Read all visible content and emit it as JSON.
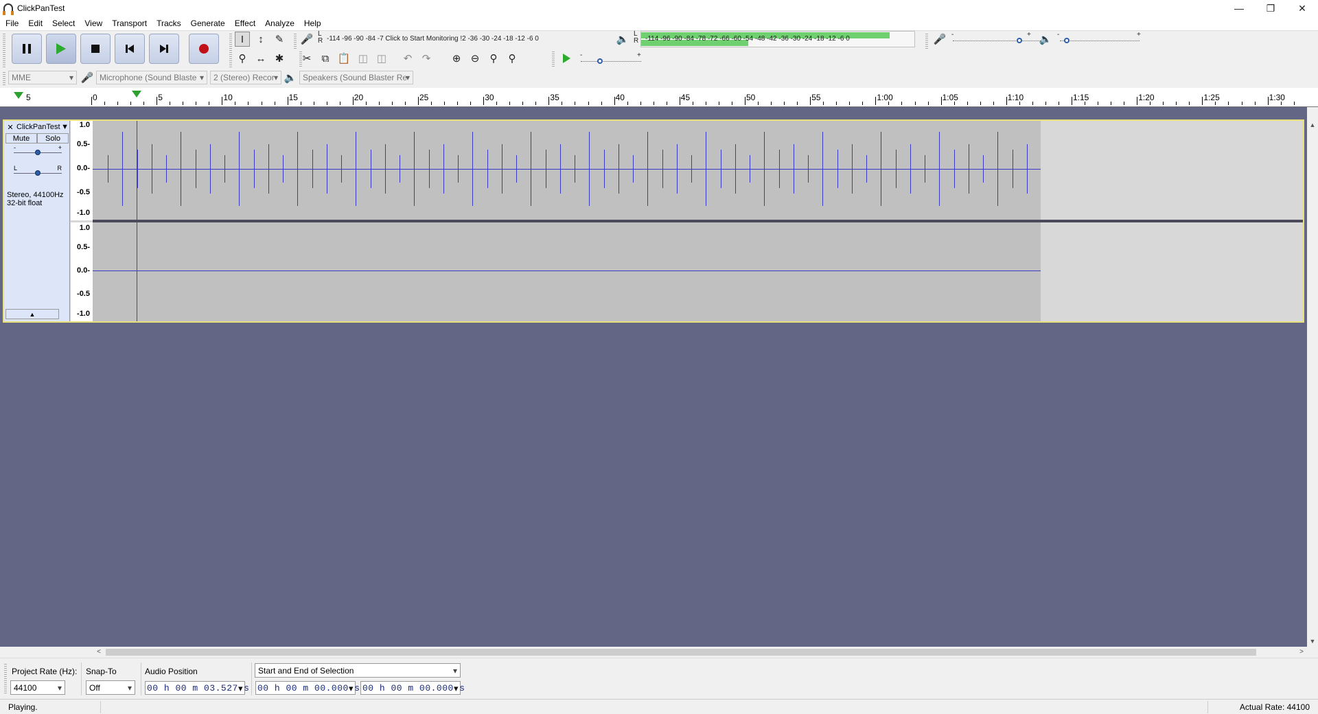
{
  "window": {
    "title": "ClickPanTest"
  },
  "menu": [
    "File",
    "Edit",
    "Select",
    "View",
    "Transport",
    "Tracks",
    "Generate",
    "Effect",
    "Analyze",
    "Help"
  ],
  "meters": {
    "record": {
      "lr": "L\nR",
      "scale": "-114   -96 -90 -84 -7 Click to Start Monitoring !2 -36 -30 -24 -18 -12  -6  0"
    },
    "playback": {
      "scale": "-114       -96 -90 -84 -78 -72 -66 -60 -54 -48 -42 -36 -30 -24 -18 -12  -6  0"
    }
  },
  "device_toolbar": {
    "host": "MME",
    "input": "Microphone (Sound Blaste",
    "channels": "2 (Stereo) Recor",
    "output": "Speakers (Sound Blaster Re"
  },
  "ruler": {
    "labels": [
      {
        "t": "5",
        "start": true
      },
      {
        "t": "0"
      },
      {
        "t": "5"
      },
      {
        "t": "10"
      },
      {
        "t": "15"
      },
      {
        "t": "20"
      },
      {
        "t": "25"
      },
      {
        "t": "30"
      },
      {
        "t": "35"
      },
      {
        "t": "40"
      },
      {
        "t": "45"
      },
      {
        "t": "50"
      },
      {
        "t": "55"
      },
      {
        "t": "1:00"
      },
      {
        "t": "1:05"
      },
      {
        "t": "1:10"
      },
      {
        "t": "1:15"
      },
      {
        "t": "1:20"
      },
      {
        "t": "1:25"
      },
      {
        "t": "1:30"
      }
    ]
  },
  "track": {
    "name": "ClickPanTest",
    "mute": "Mute",
    "solo": "Solo",
    "gain_minus": "-",
    "gain_plus": "+",
    "pan_left": "L",
    "pan_right": "R",
    "info_line1": "Stereo, 44100Hz",
    "info_line2": "32-bit float",
    "vruler_labels": [
      "1.0",
      "0.5-",
      "0.0-",
      "-0.5",
      "-1.0"
    ]
  },
  "selection_toolbar": {
    "project_rate_label": "Project Rate (Hz):",
    "project_rate": "44100",
    "snap_label": "Snap-To",
    "snap_value": "Off",
    "audio_position_label": "Audio Position",
    "audio_position": "00 h 00 m 03.527 s",
    "selection_mode": "Start and End of Selection",
    "selection_start": "00 h 00 m 00.000 s",
    "selection_end": "00 h 00 m 00.000 s"
  },
  "status": {
    "state": "Playing.",
    "actual_rate": "Actual Rate: 44100"
  }
}
